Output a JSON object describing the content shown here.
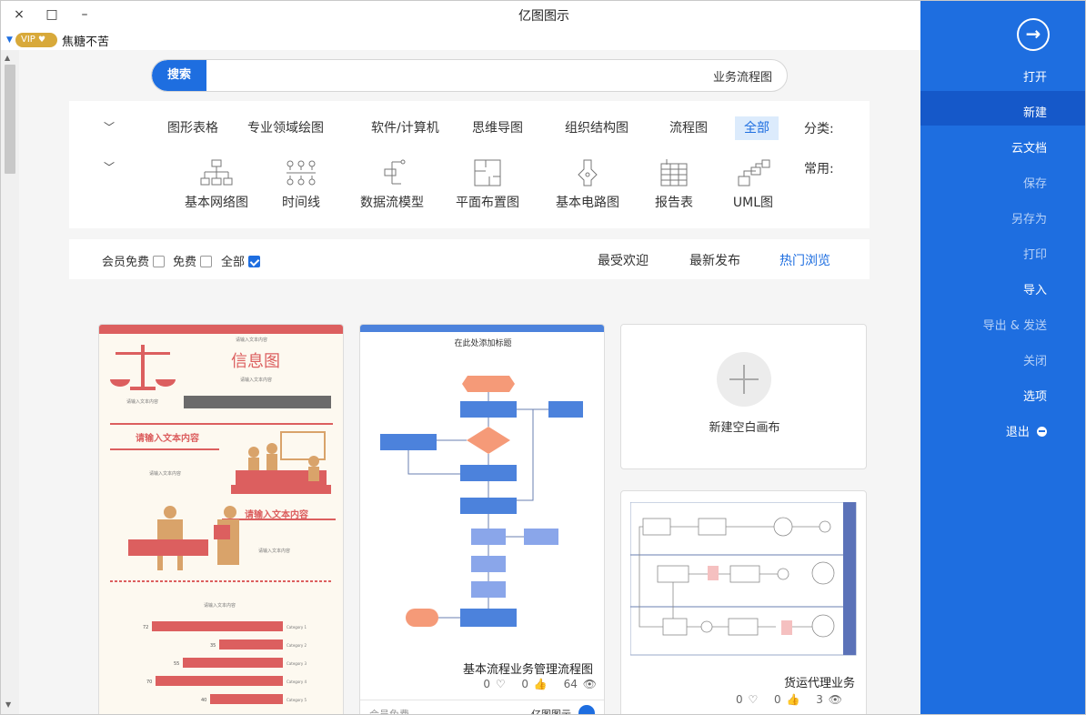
{
  "window": {
    "title": "亿图图示",
    "close": "×",
    "maximize": "□",
    "minimize": "–"
  },
  "user": {
    "vip": "VIP",
    "name": "焦糖不苦"
  },
  "search": {
    "button": "搜索",
    "value": "业务流程图"
  },
  "categories": {
    "label": "分类:",
    "items": [
      "全部",
      "流程图",
      "组织结构图",
      "思维导图",
      "软件/计算机",
      "专业领域绘图",
      "图形表格"
    ],
    "active": "全部"
  },
  "common": {
    "label": "常用:",
    "items": [
      {
        "label": "UML图",
        "icon": "uml-icon"
      },
      {
        "label": "报告表",
        "icon": "report-table-icon"
      },
      {
        "label": "基本电路图",
        "icon": "circuit-icon"
      },
      {
        "label": "平面布置图",
        "icon": "floor-plan-icon"
      },
      {
        "label": "数据流模型",
        "icon": "dataflow-icon"
      },
      {
        "label": "时间线",
        "icon": "timeline-icon"
      },
      {
        "label": "基本网络图",
        "icon": "network-icon"
      }
    ]
  },
  "sort_tabs": [
    "热门浏览",
    "最新发布",
    "最受欢迎"
  ],
  "filters": [
    {
      "label": "全部",
      "checked": true
    },
    {
      "label": "免费",
      "checked": false
    },
    {
      "label": "会员免费",
      "checked": false
    }
  ],
  "cards": {
    "blank": {
      "label": "新建空白画布"
    },
    "flowchart": {
      "header": "在此处添加标题",
      "title": "基本流程业务管理流程图",
      "views": "64",
      "likes": "0",
      "favorites": "0",
      "author": "亿图图示",
      "more": "会员免费"
    },
    "freight": {
      "title": "货运代理业务",
      "views": "3",
      "likes": "0",
      "favorites": "0"
    },
    "infographic": {
      "title": "信息图",
      "sub": "请输入文本内容",
      "heading1": "请输入文本内容",
      "heading2": "请输入文本内容",
      "small_text": "请输入文本内容",
      "chart_caption": "请输入文本内容"
    }
  },
  "sidebar": {
    "items": [
      "打开",
      "新建",
      "云文档",
      "保存",
      "另存为",
      "打印",
      "导入",
      "导出 & 发送",
      "关闭",
      "选项",
      "退出"
    ],
    "selected": "新建"
  },
  "chart_data": {
    "type": "bar",
    "categories": [
      "Category 1",
      "Category 2",
      "Category 3",
      "Category 4",
      "Category 5"
    ],
    "values": [
      72,
      35,
      55,
      70,
      40
    ],
    "xlim": [
      0,
      84
    ],
    "ticks": [
      "0",
      "12",
      "24",
      "36",
      "48",
      "60",
      "72",
      "84"
    ]
  },
  "colors": {
    "accent": "#1e6ee0",
    "sidebar": "#1e6ee0",
    "info_red": "#dc5f5f",
    "info_tan": "#d9a36a"
  }
}
